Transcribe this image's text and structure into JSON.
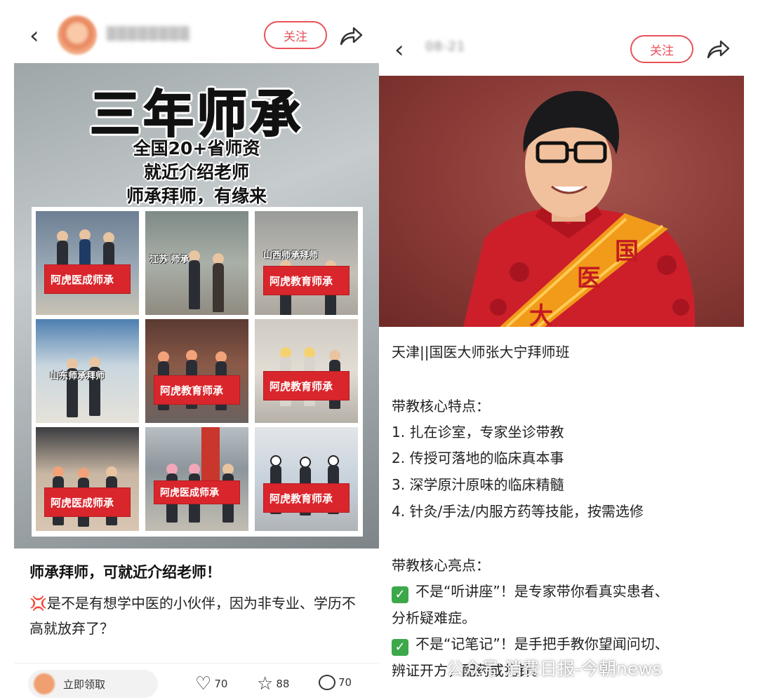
{
  "left": {
    "header": {
      "username": "▒▒▒▒▒▒▒▒",
      "follow_label": "关注"
    },
    "poster": {
      "title": "三年师承",
      "lines": [
        "全国20+省师资",
        "就近介绍老师",
        "师承拜师，有缘来"
      ],
      "cells": [
        {
          "banner": "阿虎医成师承",
          "caption": ""
        },
        {
          "banner": "",
          "caption": "江苏 师承"
        },
        {
          "banner": "阿虎教育师承",
          "caption": "山西师承拜师"
        },
        {
          "banner": "",
          "caption": "山东师承拜师"
        },
        {
          "banner": "阿虎教育师承",
          "caption": ""
        },
        {
          "banner": "阿虎教育师承",
          "caption": ""
        },
        {
          "banner": "阿虎医成师承",
          "caption": ""
        },
        {
          "banner": "阿虎医成师承",
          "caption": ""
        },
        {
          "banner": "阿虎教育师承",
          "caption": ""
        }
      ]
    },
    "post": {
      "title": "师承拜师，可就近介绍老师！",
      "body": "是不是有想学中医的小伙伴，因为非专业、学历不高就放弃了？",
      "bottom_pill": "立即领取",
      "likes": "70",
      "collects": "88",
      "comments": "70"
    }
  },
  "right": {
    "header": {
      "time": "08-21",
      "follow_label": "关注"
    },
    "photo": {
      "sash_chars": [
        "国",
        "医",
        "大"
      ]
    },
    "post": {
      "title": "天津||国医大师张大宁拜师班",
      "features_heading": "带教核心特点：",
      "features": [
        "1. 扎在诊室，专家坐诊带教",
        "2. 传授可落地的临床真本事",
        "3. 深学原汁原味的临床精髓",
        "4. 针灸/手法/内服方药等技能，按需选修"
      ],
      "highlights_heading": "带教核心亮点：",
      "highlights": [
        {
          "line1": "不是“听讲座”！是专家带你看真实患者、",
          "line2": "分析疑难症。"
        },
        {
          "line1": "不是“记笔记”！是手把手教你望闻问切、",
          "line2": "辨证开方，配药或扎针。"
        }
      ]
    }
  },
  "watermark": "公众号·消费日报-今朝news"
}
